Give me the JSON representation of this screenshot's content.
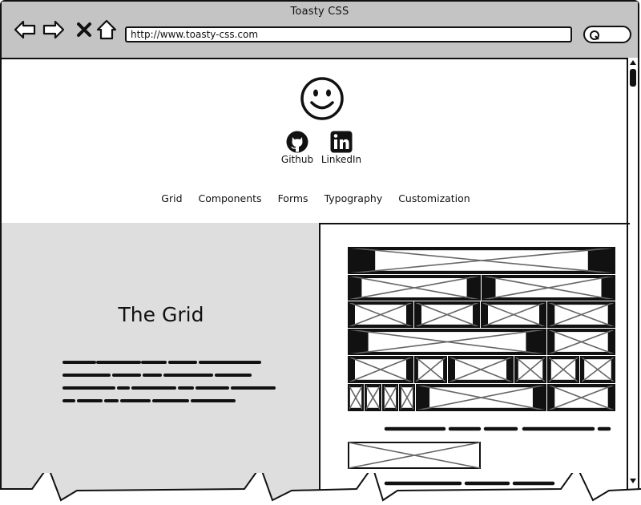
{
  "window": {
    "title": "Toasty CSS"
  },
  "browser": {
    "url": "http://www.toasty-css.com",
    "nav_icons": [
      "back-arrow-icon",
      "forward-arrow-icon",
      "close-x-icon",
      "home-icon"
    ],
    "search_icon": "magnifier-icon"
  },
  "header": {
    "logo_icon": "smiley-face-icon",
    "social": [
      {
        "label": "Github",
        "icon": "github-icon"
      },
      {
        "label": "LinkedIn",
        "icon": "linkedin-icon"
      }
    ],
    "nav": [
      "Grid",
      "Components",
      "Forms",
      "Typography",
      "Customization"
    ]
  },
  "left_panel": {
    "title": "The Grid"
  },
  "colors": {
    "chrome": "#c4c4c4",
    "left_panel": "#dedede",
    "stroke": "#111111",
    "placeholder_stroke": "#666666"
  }
}
